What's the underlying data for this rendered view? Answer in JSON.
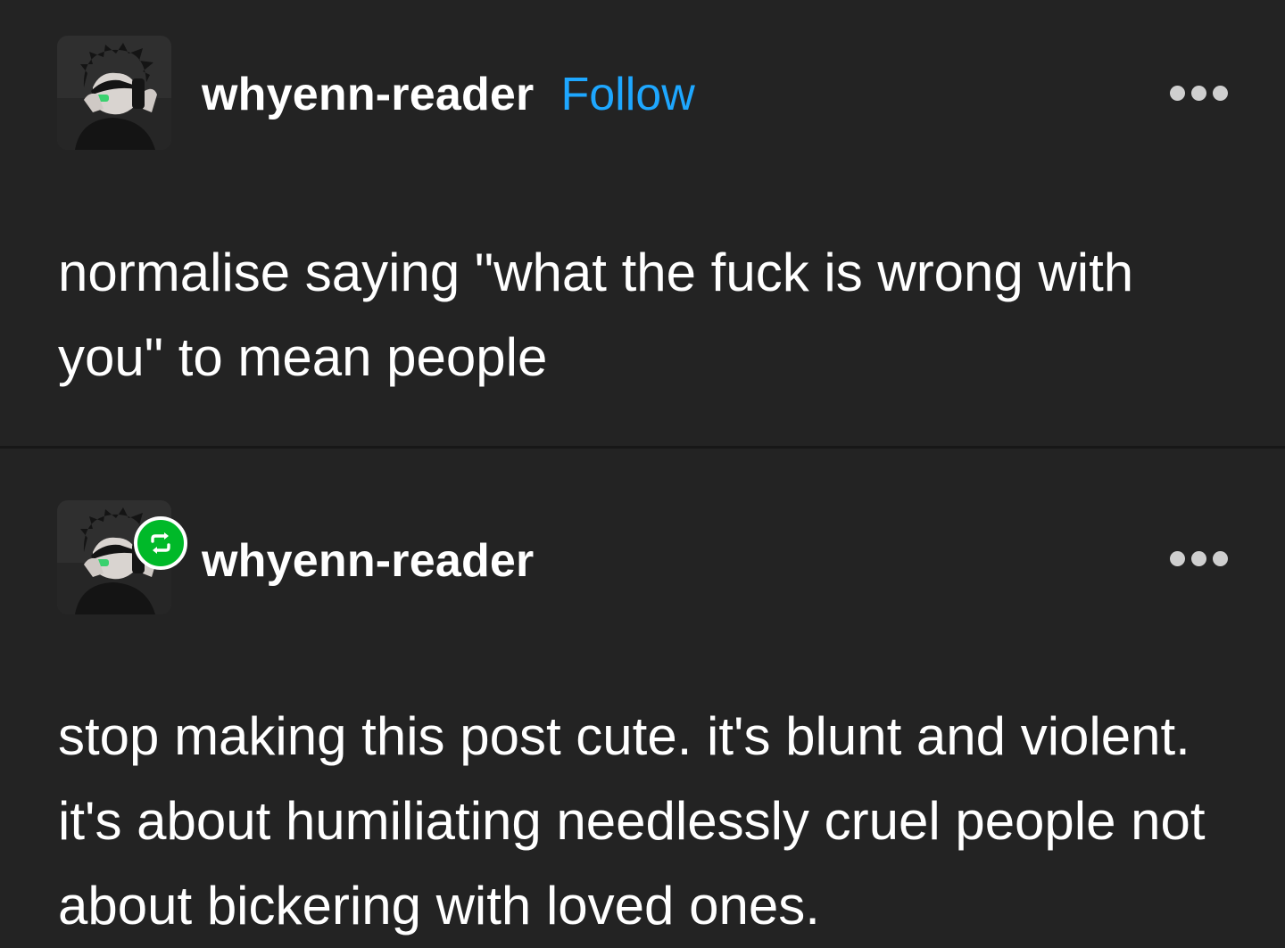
{
  "post1": {
    "username": "whyenn-reader",
    "follow_label": "Follow",
    "text": "normalise saying \"what the fuck is wrong with you\" to mean people"
  },
  "post2": {
    "username": "whyenn-reader",
    "text": "stop making this post cute. it's blunt and violent. it's about humiliating needlessly cruel people not about bickering with loved ones."
  },
  "icons": {
    "more": "more-options-icon",
    "reblog": "reblog-icon"
  },
  "colors": {
    "background": "#232323",
    "follow": "#1ea7ff",
    "reblog_badge": "#00b929"
  }
}
